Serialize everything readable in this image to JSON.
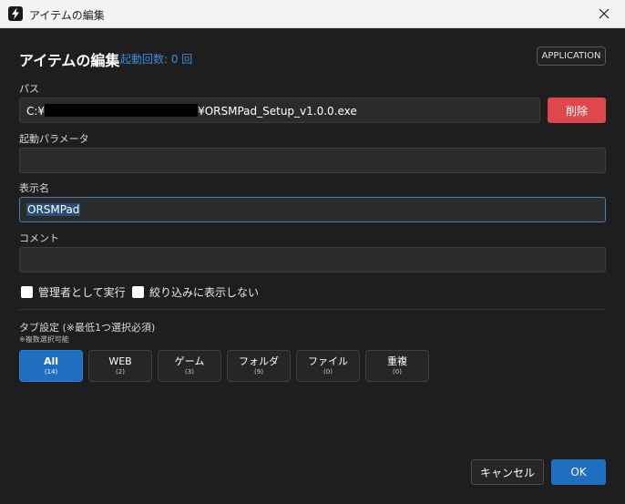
{
  "window": {
    "title": "アイテムの編集",
    "app_icon": "lightning-icon",
    "close_icon": "close-icon"
  },
  "header": {
    "title": "アイテムの編集",
    "launch_count": "起動回数: 0 回",
    "type_badge": "APPLICATION"
  },
  "path": {
    "label": "パス",
    "value_prefix": "C:¥",
    "value_suffix": "¥ORSMPad_Setup_v1.0.0.exe",
    "delete_label": "削除"
  },
  "params": {
    "label": "起動パラメータ",
    "value": ""
  },
  "display_name": {
    "label": "表示名",
    "value": "ORSMPad"
  },
  "comment": {
    "label": "コメント",
    "value": ""
  },
  "options": {
    "run_as_admin": "管理者として実行",
    "hide_in_filter": "絞り込みに表示しない"
  },
  "tabs": {
    "label": "タブ設定 (※最低1つ選択必須)",
    "note": "※複数選択可能",
    "items": [
      {
        "name": "All",
        "count": "(14)",
        "active": true
      },
      {
        "name": "WEB",
        "count": "(2)",
        "active": false
      },
      {
        "name": "ゲーム",
        "count": "(3)",
        "active": false
      },
      {
        "name": "フォルダ",
        "count": "(9)",
        "active": false
      },
      {
        "name": "ファイル",
        "count": "(0)",
        "active": false
      },
      {
        "name": "重複",
        "count": "(0)",
        "active": false
      }
    ]
  },
  "footer": {
    "cancel_label": "キャンセル",
    "ok_label": "OK"
  },
  "colors": {
    "accent": "#1f6ec0",
    "danger": "#e0474c",
    "link": "#3b8fd6",
    "background": "#1e1e1e"
  }
}
